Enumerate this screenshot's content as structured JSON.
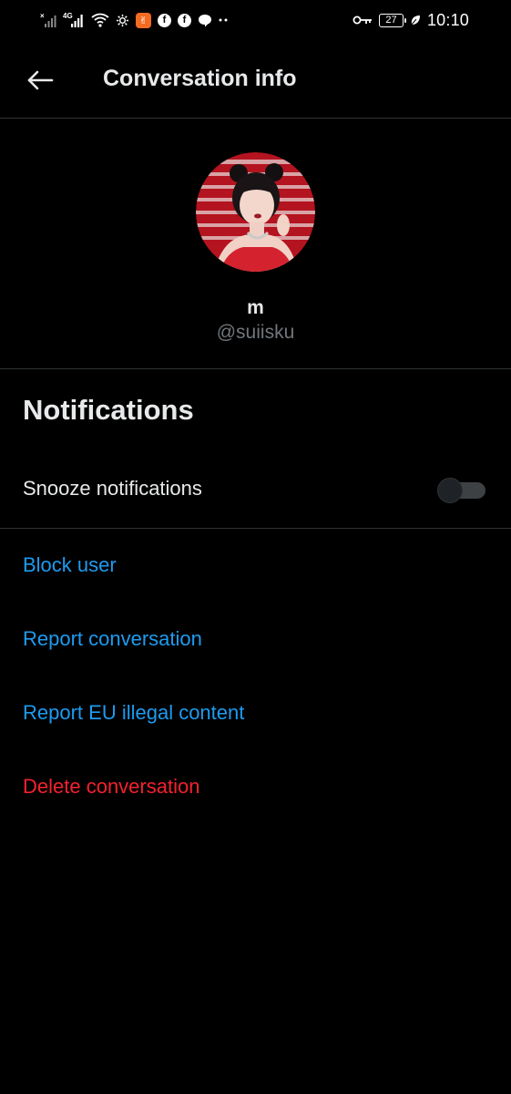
{
  "status_bar": {
    "left_icons": [
      "signal-x-icon",
      "signal-4g-icon",
      "wifi-icon",
      "settings-gear-icon",
      "app-notification-icon",
      "facebook-icon",
      "facebook-icon",
      "chat-bubble-icon",
      "more-dots-icon"
    ],
    "network_label": "4G",
    "battery_level": "27",
    "time": "10:10",
    "app_chip_glyph": "✌"
  },
  "header": {
    "back_icon": "arrow-left-icon",
    "title": "Conversation info"
  },
  "profile": {
    "display_name": "m",
    "handle": "@suiisku"
  },
  "notifications": {
    "section_title": "Notifications",
    "snooze_label": "Snooze notifications",
    "snooze_enabled": false
  },
  "actions": {
    "block_user": "Block user",
    "report_conversation": "Report conversation",
    "report_eu_illegal": "Report EU illegal content",
    "delete_conversation": "Delete conversation"
  },
  "colors": {
    "background": "#000000",
    "link_blue": "#1d9bf0",
    "danger_red": "#f4212e",
    "secondary_text": "#71767b",
    "divider": "#2f3336"
  }
}
